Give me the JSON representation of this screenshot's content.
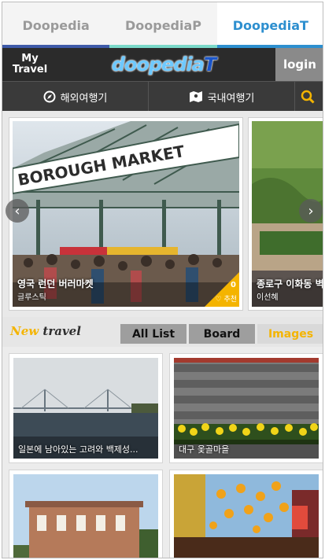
{
  "brand_tabs": [
    {
      "label": "Doopedia",
      "color": "#3e5aa8"
    },
    {
      "label": "DoopediaP",
      "color": "#7bd9c9"
    },
    {
      "label": "DoopediaT",
      "color": "#2d8fcf",
      "active": true
    }
  ],
  "header": {
    "my_travel_line1": "My",
    "my_travel_line2": "Travel",
    "logo_prefix": "doopedia",
    "logo_suffix": "T",
    "login_label": "login"
  },
  "nav": {
    "overseas_label": "해외여행기",
    "domestic_label": "국내여행기",
    "search_icon": "search-icon"
  },
  "carousel": {
    "items": [
      {
        "title": "영국 런던 버러마켓",
        "author": "글루스틱",
        "likes": "0",
        "like_label": "추천",
        "sign_text": "BOROUGH MARKET"
      },
      {
        "title": "종로구 이화동 벽",
        "author": "이선혜"
      }
    ]
  },
  "section": {
    "title_new": "New",
    "title_rest": " travel",
    "tabs": [
      "All List",
      "Board",
      "Images"
    ]
  },
  "grid": {
    "items": [
      {
        "caption": "일본에 남아있는 고려와 백제성..."
      },
      {
        "caption": "대구 옻골마을"
      },
      {
        "caption": ""
      },
      {
        "caption": ""
      }
    ]
  },
  "colors": {
    "accent": "#f4b400",
    "brand_blue": "#2d8fcf",
    "header_dark": "#2b2b2b"
  }
}
